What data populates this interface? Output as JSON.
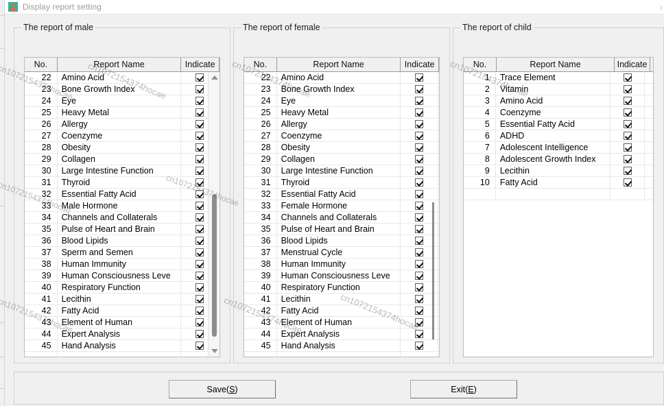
{
  "window": {
    "title": "Display report setting",
    "icon": "person-icon",
    "close_label": "›"
  },
  "groups": {
    "male": {
      "title": "The report of male",
      "columns": [
        "No.",
        "Report Name",
        "Indicate"
      ],
      "rows": [
        {
          "no": "22",
          "name": "Amino Acid",
          "checked": true
        },
        {
          "no": "23",
          "name": "Bone Growth Index",
          "checked": true
        },
        {
          "no": "24",
          "name": "Eye",
          "checked": true
        },
        {
          "no": "25",
          "name": "Heavy Metal",
          "checked": true
        },
        {
          "no": "26",
          "name": "Allergy",
          "checked": true
        },
        {
          "no": "27",
          "name": "Coenzyme",
          "checked": true
        },
        {
          "no": "28",
          "name": "Obesity",
          "checked": true
        },
        {
          "no": "29",
          "name": "Collagen",
          "checked": true
        },
        {
          "no": "30",
          "name": "Large Intestine Function",
          "checked": true
        },
        {
          "no": "31",
          "name": "Thyroid",
          "checked": true
        },
        {
          "no": "32",
          "name": "Essential Fatty Acid",
          "checked": true
        },
        {
          "no": "33",
          "name": "Male Hormone",
          "checked": true
        },
        {
          "no": "34",
          "name": "Channels and Collaterals",
          "checked": true
        },
        {
          "no": "35",
          "name": "Pulse of Heart and Brain",
          "checked": true
        },
        {
          "no": "36",
          "name": "Blood Lipids",
          "checked": true
        },
        {
          "no": "37",
          "name": "Sperm and Semen",
          "checked": true
        },
        {
          "no": "38",
          "name": "Human Immunity",
          "checked": true
        },
        {
          "no": "39",
          "name": "Human Consciousness Leve",
          "checked": true
        },
        {
          "no": "40",
          "name": "Respiratory Function",
          "checked": true
        },
        {
          "no": "41",
          "name": "Lecithin",
          "checked": true
        },
        {
          "no": "42",
          "name": "Fatty Acid",
          "checked": true
        },
        {
          "no": "43",
          "name": "Element of Human",
          "checked": true
        },
        {
          "no": "44",
          "name": "Expert Analysis",
          "checked": true
        },
        {
          "no": "45",
          "name": "Hand Analysis",
          "checked": true
        }
      ]
    },
    "female": {
      "title": "The report of female",
      "columns": [
        "No.",
        "Report Name",
        "Indicate"
      ],
      "rows": [
        {
          "no": "22",
          "name": "Amino Acid",
          "checked": true
        },
        {
          "no": "23",
          "name": "Bone Growth Index",
          "checked": true
        },
        {
          "no": "24",
          "name": "Eye",
          "checked": true
        },
        {
          "no": "25",
          "name": "Heavy Metal",
          "checked": true
        },
        {
          "no": "26",
          "name": "Allergy",
          "checked": true
        },
        {
          "no": "27",
          "name": "Coenzyme",
          "checked": true
        },
        {
          "no": "28",
          "name": "Obesity",
          "checked": true
        },
        {
          "no": "29",
          "name": "Collagen",
          "checked": true
        },
        {
          "no": "30",
          "name": "Large Intestine Function",
          "checked": true
        },
        {
          "no": "31",
          "name": "Thyroid",
          "checked": true
        },
        {
          "no": "32",
          "name": "Essential Fatty Acid",
          "checked": true
        },
        {
          "no": "33",
          "name": "Female Hormone",
          "checked": true
        },
        {
          "no": "34",
          "name": "Channels and Collaterals",
          "checked": true
        },
        {
          "no": "35",
          "name": "Pulse of Heart and Brain",
          "checked": true
        },
        {
          "no": "36",
          "name": "Blood Lipids",
          "checked": true
        },
        {
          "no": "37",
          "name": "Menstrual Cycle",
          "checked": true
        },
        {
          "no": "38",
          "name": "Human Immunity",
          "checked": true
        },
        {
          "no": "39",
          "name": "Human Consciousness Leve",
          "checked": true
        },
        {
          "no": "40",
          "name": "Respiratory Function",
          "checked": true
        },
        {
          "no": "41",
          "name": "Lecithin",
          "checked": true
        },
        {
          "no": "42",
          "name": "Fatty Acid",
          "checked": true
        },
        {
          "no": "43",
          "name": "Element of Human",
          "checked": true
        },
        {
          "no": "44",
          "name": "Expert Analysis",
          "checked": true
        },
        {
          "no": "45",
          "name": "Hand Analysis",
          "checked": true
        }
      ]
    },
    "child": {
      "title": "The report of child",
      "columns": [
        "No.",
        "Report Name",
        "Indicate",
        ""
      ],
      "rows": [
        {
          "no": "1",
          "name": "Trace Element",
          "checked": true
        },
        {
          "no": "2",
          "name": "Vitamin",
          "checked": true
        },
        {
          "no": "3",
          "name": "Amino Acid",
          "checked": true
        },
        {
          "no": "4",
          "name": "Coenzyme",
          "checked": true
        },
        {
          "no": "5",
          "name": "Essential Fatty Acid",
          "checked": true
        },
        {
          "no": "6",
          "name": "ADHD",
          "checked": true
        },
        {
          "no": "7",
          "name": "Adolescent Intelligence",
          "checked": true
        },
        {
          "no": "8",
          "name": "Adolescent Growth Index",
          "checked": true
        },
        {
          "no": "9",
          "name": "Lecithin",
          "checked": true
        },
        {
          "no": "10",
          "name": "Fatty Acid",
          "checked": true
        }
      ]
    }
  },
  "buttons": {
    "save": {
      "text": "Save(",
      "accel": "S",
      "tail": ")"
    },
    "exit": {
      "text": "Exit(",
      "accel": "E",
      "tail": ")"
    }
  },
  "watermark": {
    "text": "cn1072154374hocae"
  }
}
